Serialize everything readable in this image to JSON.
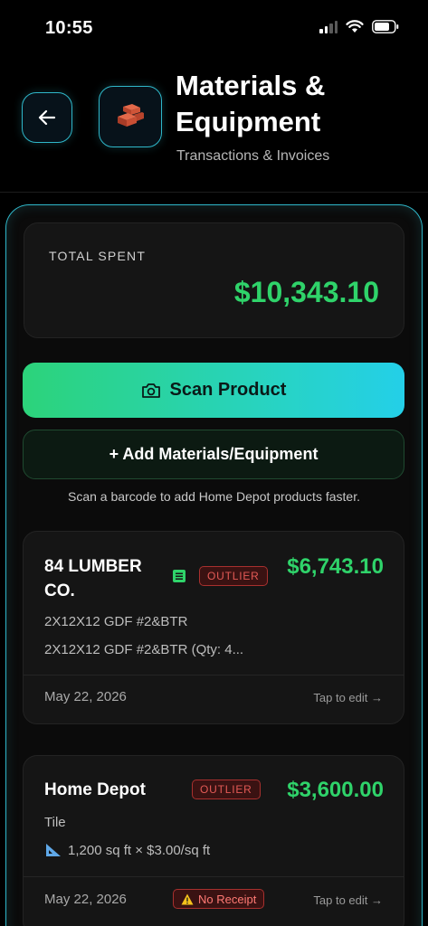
{
  "status_bar": {
    "time": "10:55"
  },
  "header": {
    "title": "Materials & Equipment",
    "subtitle": "Transactions & Invoices"
  },
  "summary": {
    "label": "TOTAL SPENT",
    "value": "$10,343.10"
  },
  "actions": {
    "scan_label": "Scan Product",
    "add_label": "+ Add Materials/Equipment",
    "hint": "Scan a barcode to add Home Depot products faster."
  },
  "transactions": [
    {
      "vendor_line1": "84 LUMBER",
      "vendor_line2": "CO.",
      "badge": "OUTLIER",
      "amount": "$6,743.10",
      "line1": "2X12X12 GDF #2&BTR",
      "line2": "2X12X12 GDF #2&BTR (Qty: 4...",
      "date": "May 22, 2026",
      "edit": "Tap to edit →"
    },
    {
      "vendor_line1": "Home Depot",
      "badge": "OUTLIER",
      "amount": "$3,600.00",
      "line1": "Tile",
      "line2": "1,200 sq ft × $3.00/sq ft",
      "date": "May 22, 2026",
      "receipt_badge": "No Receipt",
      "edit": "Tap to edit →"
    }
  ],
  "colors": {
    "accent": "#2fb7c9",
    "money": "#2fd36a",
    "outlier": "#e35a56"
  },
  "icons": [
    "back-arrow-icon",
    "brick-icon",
    "camera-icon",
    "document-icon",
    "ruler-icon",
    "warning-icon",
    "signal-icon",
    "wifi-icon",
    "battery-icon"
  ]
}
